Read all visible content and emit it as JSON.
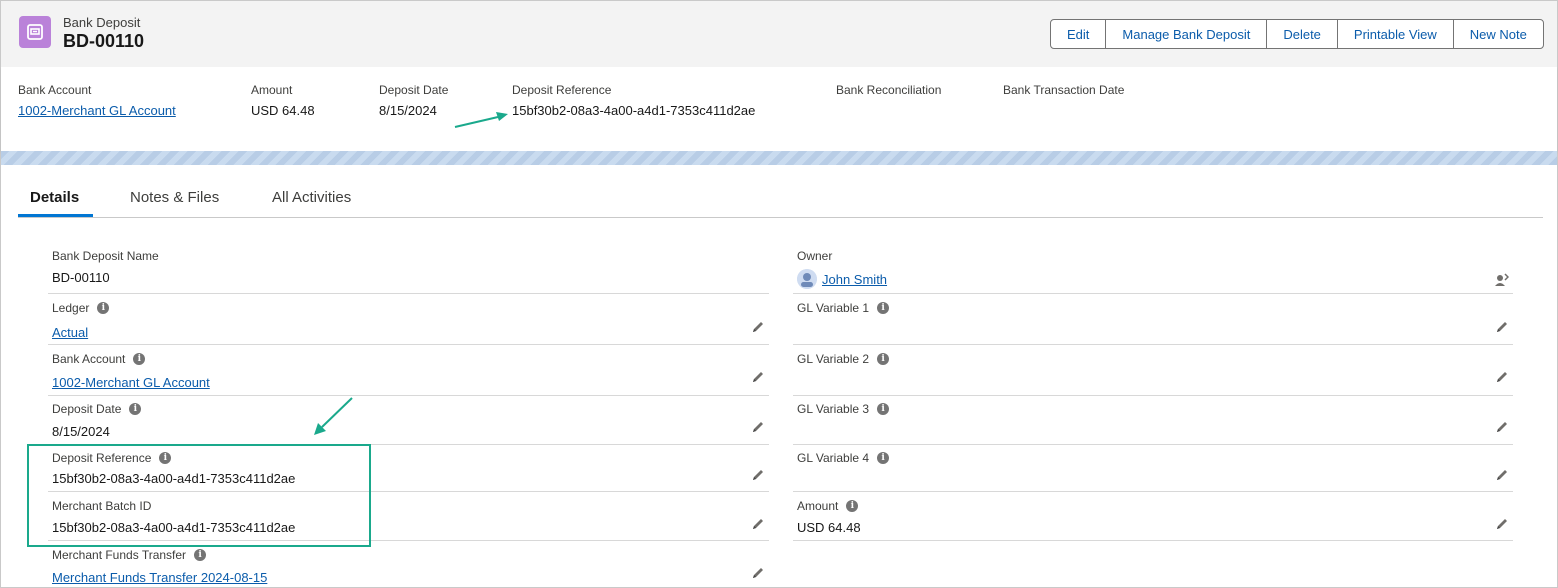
{
  "header": {
    "object_type": "Bank Deposit",
    "record_name": "BD-00110",
    "buttons": [
      "Edit",
      "Manage Bank Deposit",
      "Delete",
      "Printable View",
      "New Note"
    ],
    "fields": [
      {
        "label": "Bank Account",
        "value": "1002-Merchant GL Account",
        "link": true
      },
      {
        "label": "Amount",
        "value": "USD 64.48",
        "link": false
      },
      {
        "label": "Deposit Date",
        "value": "8/15/2024",
        "link": false
      },
      {
        "label": "Deposit Reference",
        "value": "15bf30b2-08a3-4a00-a4d1-7353c411d2ae",
        "link": false
      },
      {
        "label": "Bank Reconciliation",
        "value": "",
        "link": false
      },
      {
        "label": "Bank Transaction Date",
        "value": "",
        "link": false
      }
    ]
  },
  "tabs": [
    "Details",
    "Notes & Files",
    "All Activities"
  ],
  "details": {
    "left": [
      {
        "label": "Bank Deposit Name",
        "value": "BD-00110",
        "info": false,
        "editable": false,
        "link": false
      },
      {
        "label": "Ledger",
        "value": "Actual",
        "info": true,
        "editable": true,
        "link": true
      },
      {
        "label": "Bank Account",
        "value": "1002-Merchant GL Account",
        "info": true,
        "editable": true,
        "link": true
      },
      {
        "label": "Deposit Date",
        "value": "8/15/2024",
        "info": true,
        "editable": true,
        "link": false
      },
      {
        "label": "Deposit Reference",
        "value": "15bf30b2-08a3-4a00-a4d1-7353c411d2ae",
        "info": true,
        "editable": true,
        "link": false
      },
      {
        "label": "Merchant Batch ID",
        "value": "15bf30b2-08a3-4a00-a4d1-7353c411d2ae",
        "info": false,
        "editable": true,
        "link": false
      },
      {
        "label": "Merchant Funds Transfer",
        "value": "Merchant Funds Transfer 2024-08-15",
        "info": true,
        "editable": true,
        "link": true
      }
    ],
    "right": [
      {
        "label": "Owner",
        "value": "John Smith",
        "info": false,
        "editable": false,
        "link": true
      },
      {
        "label": "GL Variable 1",
        "value": "",
        "info": true,
        "editable": true,
        "link": false
      },
      {
        "label": "GL Variable 2",
        "value": "",
        "info": true,
        "editable": true,
        "link": false
      },
      {
        "label": "GL Variable 3",
        "value": "",
        "info": true,
        "editable": true,
        "link": false
      },
      {
        "label": "GL Variable 4",
        "value": "",
        "info": true,
        "editable": true,
        "link": false
      },
      {
        "label": "Amount",
        "value": "USD 64.48",
        "info": true,
        "editable": true,
        "link": false
      }
    ]
  },
  "icons": {
    "object": "bank-deposit-icon",
    "info": "info-icon",
    "edit": "pencil-icon",
    "owner_avatar": "avatar-icon",
    "change_owner": "change-owner-icon"
  },
  "colors": {
    "accent": "#0176d3",
    "link": "#0b5cab",
    "object_icon": "#ba82d9",
    "annotation": "#1aa98c"
  }
}
